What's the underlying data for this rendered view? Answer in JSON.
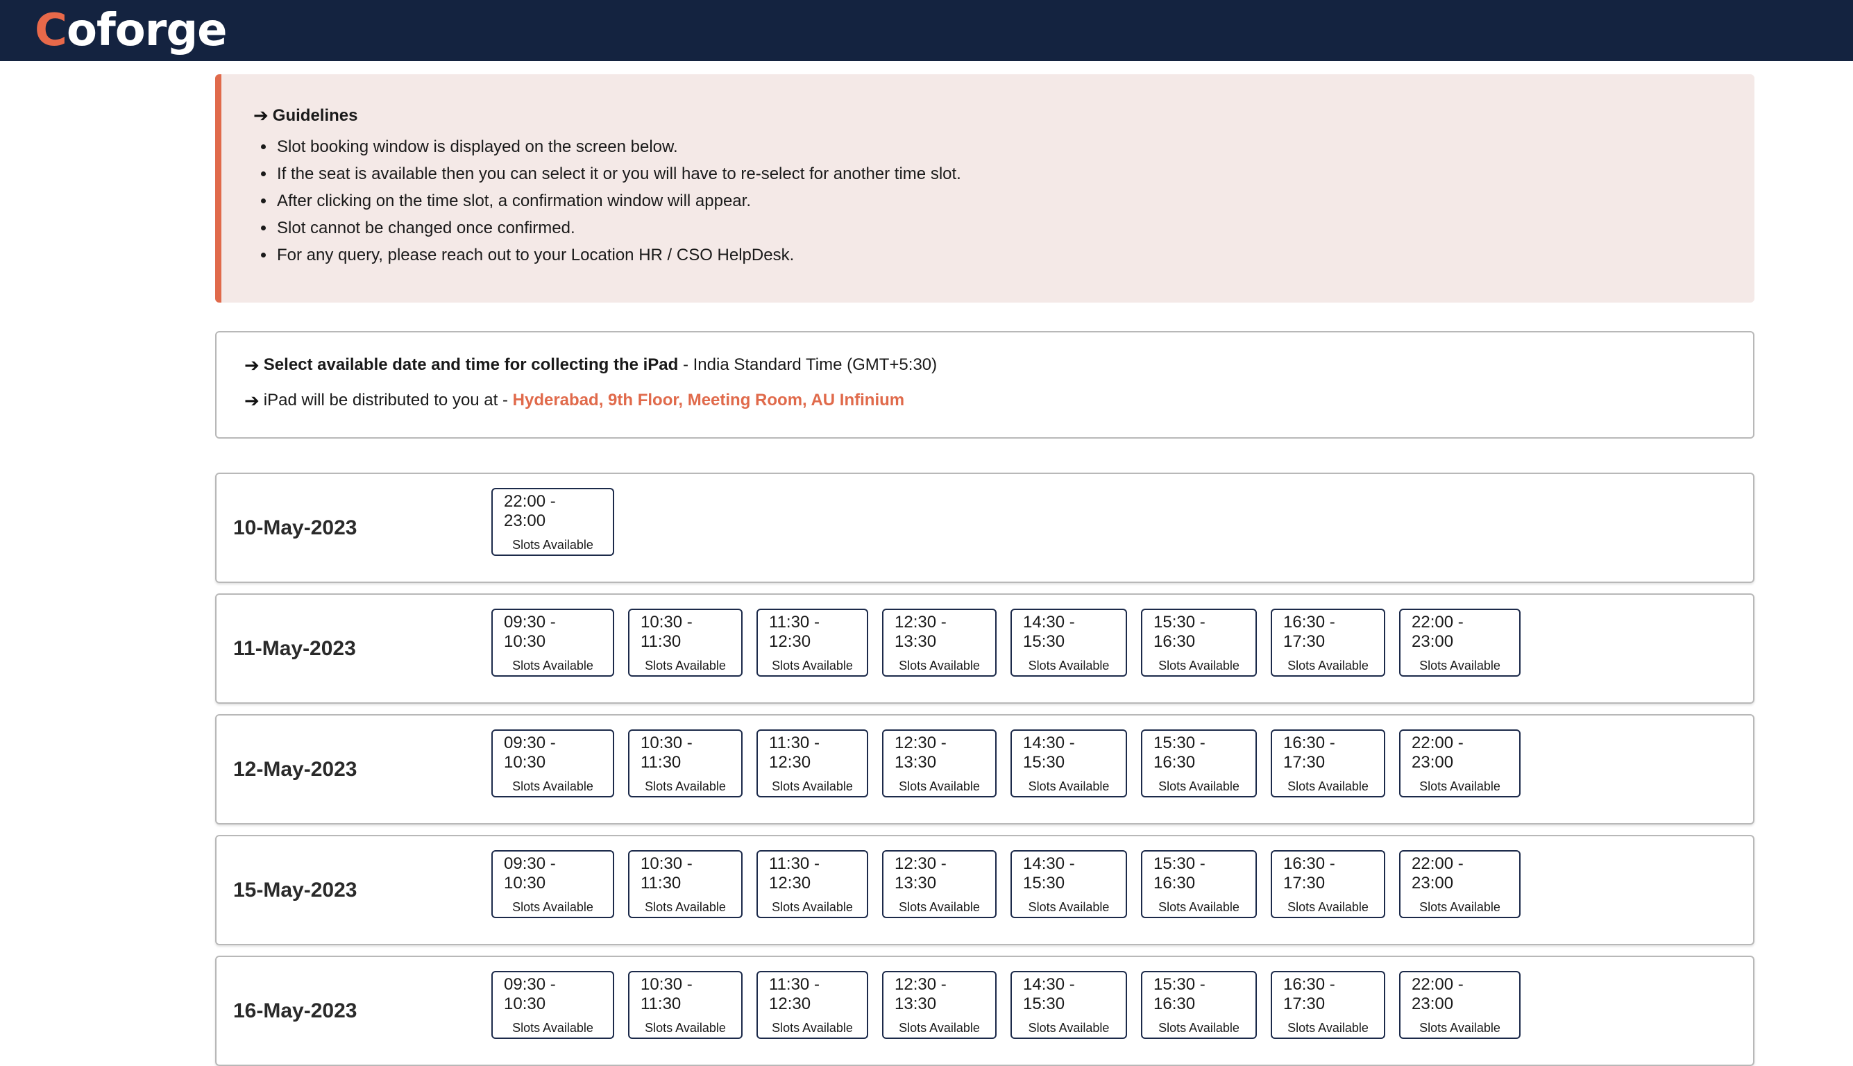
{
  "header": {
    "logo_first": "C",
    "logo_rest": "oforge"
  },
  "guidelines": {
    "title": "Guidelines",
    "items": [
      "Slot booking window is displayed on the screen below.",
      "If the seat is available then you can select it or you will have to re-select for another time slot.",
      "After clicking on the time slot, a confirmation window will appear.",
      "Slot cannot be changed once confirmed.",
      "For any query, please reach out to your Location HR / CSO HelpDesk."
    ]
  },
  "info": {
    "select_label": "Select available date and time for collecting the iPad",
    "timezone": " - India Standard Time (GMT+5:30)",
    "distribution_prefix": "iPad will be distributed to you at - ",
    "location": "Hyderabad, 9th Floor, Meeting Room, AU Infinium"
  },
  "dates": [
    {
      "date": "10-May-2023",
      "slots": [
        {
          "time": "22:00 - 23:00",
          "status": "Slots Available"
        }
      ]
    },
    {
      "date": "11-May-2023",
      "slots": [
        {
          "time": "09:30 - 10:30",
          "status": "Slots Available"
        },
        {
          "time": "10:30 - 11:30",
          "status": "Slots Available"
        },
        {
          "time": "11:30 - 12:30",
          "status": "Slots Available"
        },
        {
          "time": "12:30 - 13:30",
          "status": "Slots Available"
        },
        {
          "time": "14:30 - 15:30",
          "status": "Slots Available"
        },
        {
          "time": "15:30 - 16:30",
          "status": "Slots Available"
        },
        {
          "time": "16:30 - 17:30",
          "status": "Slots Available"
        },
        {
          "time": "22:00 - 23:00",
          "status": "Slots Available"
        }
      ]
    },
    {
      "date": "12-May-2023",
      "slots": [
        {
          "time": "09:30 - 10:30",
          "status": "Slots Available"
        },
        {
          "time": "10:30 - 11:30",
          "status": "Slots Available"
        },
        {
          "time": "11:30 - 12:30",
          "status": "Slots Available"
        },
        {
          "time": "12:30 - 13:30",
          "status": "Slots Available"
        },
        {
          "time": "14:30 - 15:30",
          "status": "Slots Available"
        },
        {
          "time": "15:30 - 16:30",
          "status": "Slots Available"
        },
        {
          "time": "16:30 - 17:30",
          "status": "Slots Available"
        },
        {
          "time": "22:00 - 23:00",
          "status": "Slots Available"
        }
      ]
    },
    {
      "date": "15-May-2023",
      "slots": [
        {
          "time": "09:30 - 10:30",
          "status": "Slots Available"
        },
        {
          "time": "10:30 - 11:30",
          "status": "Slots Available"
        },
        {
          "time": "11:30 - 12:30",
          "status": "Slots Available"
        },
        {
          "time": "12:30 - 13:30",
          "status": "Slots Available"
        },
        {
          "time": "14:30 - 15:30",
          "status": "Slots Available"
        },
        {
          "time": "15:30 - 16:30",
          "status": "Slots Available"
        },
        {
          "time": "16:30 - 17:30",
          "status": "Slots Available"
        },
        {
          "time": "22:00 - 23:00",
          "status": "Slots Available"
        }
      ]
    },
    {
      "date": "16-May-2023",
      "slots": [
        {
          "time": "09:30 - 10:30",
          "status": "Slots Available"
        },
        {
          "time": "10:30 - 11:30",
          "status": "Slots Available"
        },
        {
          "time": "11:30 - 12:30",
          "status": "Slots Available"
        },
        {
          "time": "12:30 - 13:30",
          "status": "Slots Available"
        },
        {
          "time": "14:30 - 15:30",
          "status": "Slots Available"
        },
        {
          "time": "15:30 - 16:30",
          "status": "Slots Available"
        },
        {
          "time": "16:30 - 17:30",
          "status": "Slots Available"
        },
        {
          "time": "22:00 - 23:00",
          "status": "Slots Available"
        }
      ]
    }
  ]
}
